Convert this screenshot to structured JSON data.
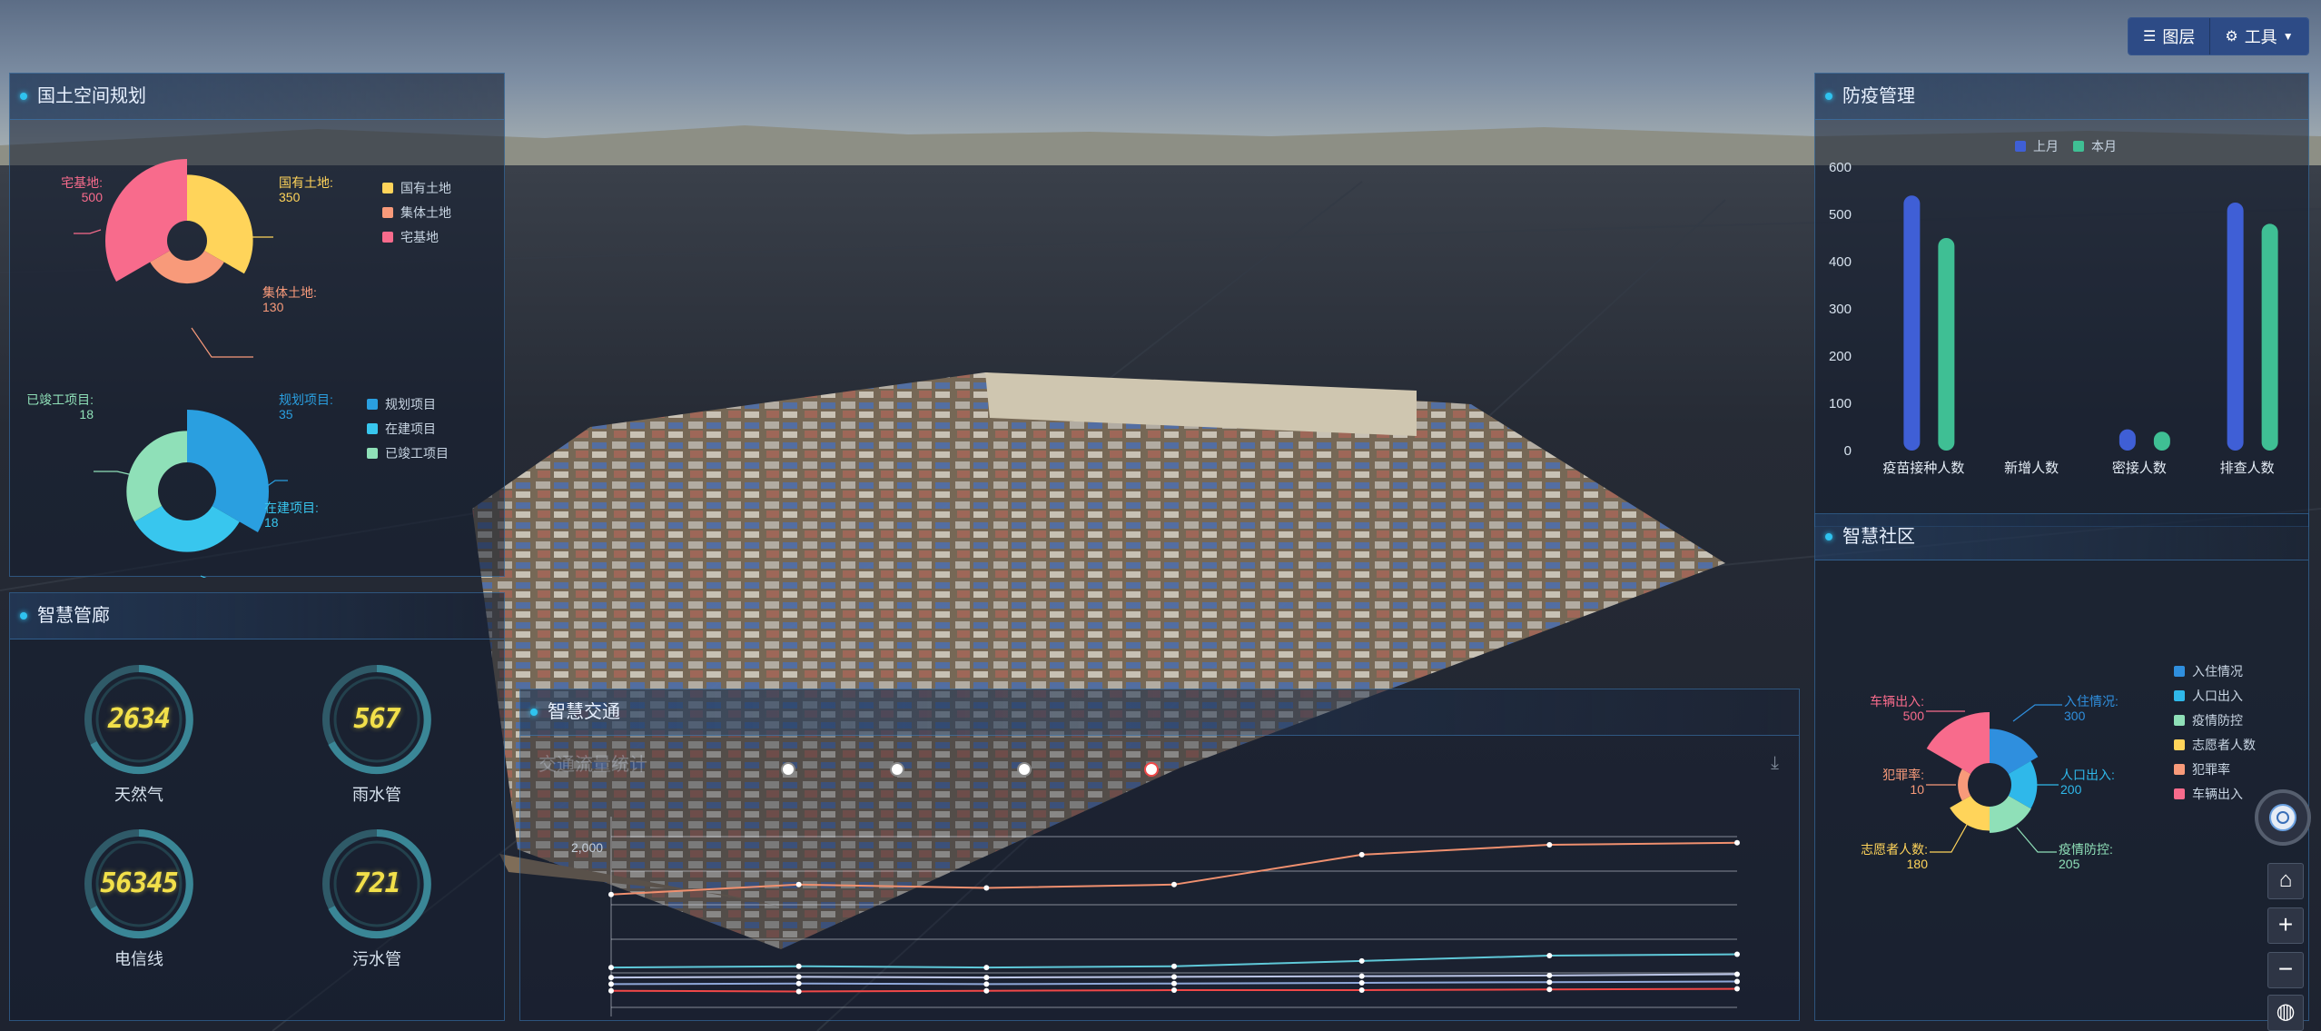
{
  "toolbar": {
    "layers_label": "图层",
    "tools_label": "工具"
  },
  "land_panel": {
    "title": "国土空间规划",
    "pie1": {
      "legend": [
        {
          "name": "国有土地",
          "color": "#ffd45a"
        },
        {
          "name": "集体土地",
          "color": "#f89a7a"
        },
        {
          "name": "宅基地",
          "color": "#f86b8c"
        }
      ],
      "labels": [
        {
          "name": "宅基地:",
          "value": "500",
          "color": "#f86b8c"
        },
        {
          "name": "国有土地:",
          "value": "350",
          "color": "#ffd45a"
        },
        {
          "name": "集体土地:",
          "value": "130",
          "color": "#f89a7a"
        }
      ]
    },
    "pie2": {
      "legend": [
        {
          "name": "规划项目",
          "color": "#2a9fe0"
        },
        {
          "name": "在建项目",
          "color": "#38c6ee"
        },
        {
          "name": "已竣工项目",
          "color": "#8fe0b8"
        }
      ],
      "labels": [
        {
          "name": "已竣工项目:",
          "value": "18",
          "color": "#8fe0b8"
        },
        {
          "name": "规划项目:",
          "value": "35",
          "color": "#2a9fe0"
        },
        {
          "name": "在建项目:",
          "value": "18",
          "color": "#38c6ee"
        }
      ]
    }
  },
  "pipe_panel": {
    "title": "智慧管廊",
    "gauges": [
      {
        "value": "2634",
        "label": "天然气"
      },
      {
        "value": "567",
        "label": "雨水管"
      },
      {
        "value": "56345",
        "label": "电信线"
      },
      {
        "value": "721",
        "label": "污水管"
      }
    ]
  },
  "traffic_panel": {
    "title": "智慧交通",
    "chart_title": "交通流量统计",
    "ytick": "2,000"
  },
  "epidemic_panel": {
    "title": "防疫管理",
    "legend": [
      {
        "name": "上月",
        "color": "#3f5fd6"
      },
      {
        "name": "本月",
        "color": "#3fbf94"
      }
    ]
  },
  "community_panel": {
    "title": "智慧社区",
    "legend": [
      {
        "name": "入住情况",
        "color": "#2f8fde"
      },
      {
        "name": "人口出入",
        "color": "#2fb8ea"
      },
      {
        "name": "疫情防控",
        "color": "#8fe0b8"
      },
      {
        "name": "志愿者人数",
        "color": "#ffd45a"
      },
      {
        "name": "犯罪率",
        "color": "#f89a7a"
      },
      {
        "name": "车辆出入",
        "color": "#f86b8c"
      }
    ],
    "labels": [
      {
        "name": "车辆出入:",
        "value": "500",
        "color": "#f86b8c"
      },
      {
        "name": "入住情况:",
        "value": "300",
        "color": "#2f8fde"
      },
      {
        "name": "犯罪率:",
        "value": "10",
        "color": "#f89a7a"
      },
      {
        "name": "人口出入:",
        "value": "200",
        "color": "#2fb8ea"
      },
      {
        "name": "志愿者人数:",
        "value": "180",
        "color": "#ffd45a"
      },
      {
        "name": "疫情防控:",
        "value": "205",
        "color": "#8fe0b8"
      }
    ]
  },
  "chart_data": [
    {
      "type": "pie",
      "categories": [
        "国有土地",
        "集体土地",
        "宅基地"
      ],
      "values": [
        350,
        130,
        500
      ]
    },
    {
      "type": "pie",
      "categories": [
        "规划项目",
        "在建项目",
        "已竣工项目"
      ],
      "values": [
        35,
        18,
        18
      ]
    },
    {
      "type": "bar",
      "categories": [
        "疫苗接种人数",
        "新增人数",
        "密接人数",
        "排查人数"
      ],
      "series": [
        {
          "name": "上月",
          "values": [
            540,
            0,
            45,
            525
          ]
        },
        {
          "name": "本月",
          "values": [
            450,
            0,
            40,
            480
          ]
        }
      ],
      "yticks": [
        "0",
        "100",
        "200",
        "300",
        "400",
        "500",
        "600"
      ],
      "ylim": [
        0,
        600
      ]
    },
    {
      "type": "pie",
      "categories": [
        "入住情况",
        "人口出入",
        "疫情防控",
        "志愿者人数",
        "犯罪率",
        "车辆出入"
      ],
      "values": [
        300,
        200,
        205,
        180,
        10,
        500
      ]
    },
    {
      "type": "line",
      "title": "交通流量统计",
      "series": [
        {
          "values": [
            1700,
            1850,
            1800,
            1850,
            2300,
            2450,
            2480
          ]
        },
        {
          "values": [
            600,
            620,
            600,
            620,
            700,
            780,
            800
          ]
        },
        {
          "values": [
            450,
            460,
            450,
            460,
            470,
            480,
            500
          ]
        },
        {
          "values": [
            350,
            360,
            350,
            360,
            370,
            380,
            390
          ]
        },
        {
          "values": [
            250,
            240,
            250,
            260,
            260,
            270,
            280
          ]
        }
      ],
      "ytick_shown": "2,000"
    }
  ]
}
